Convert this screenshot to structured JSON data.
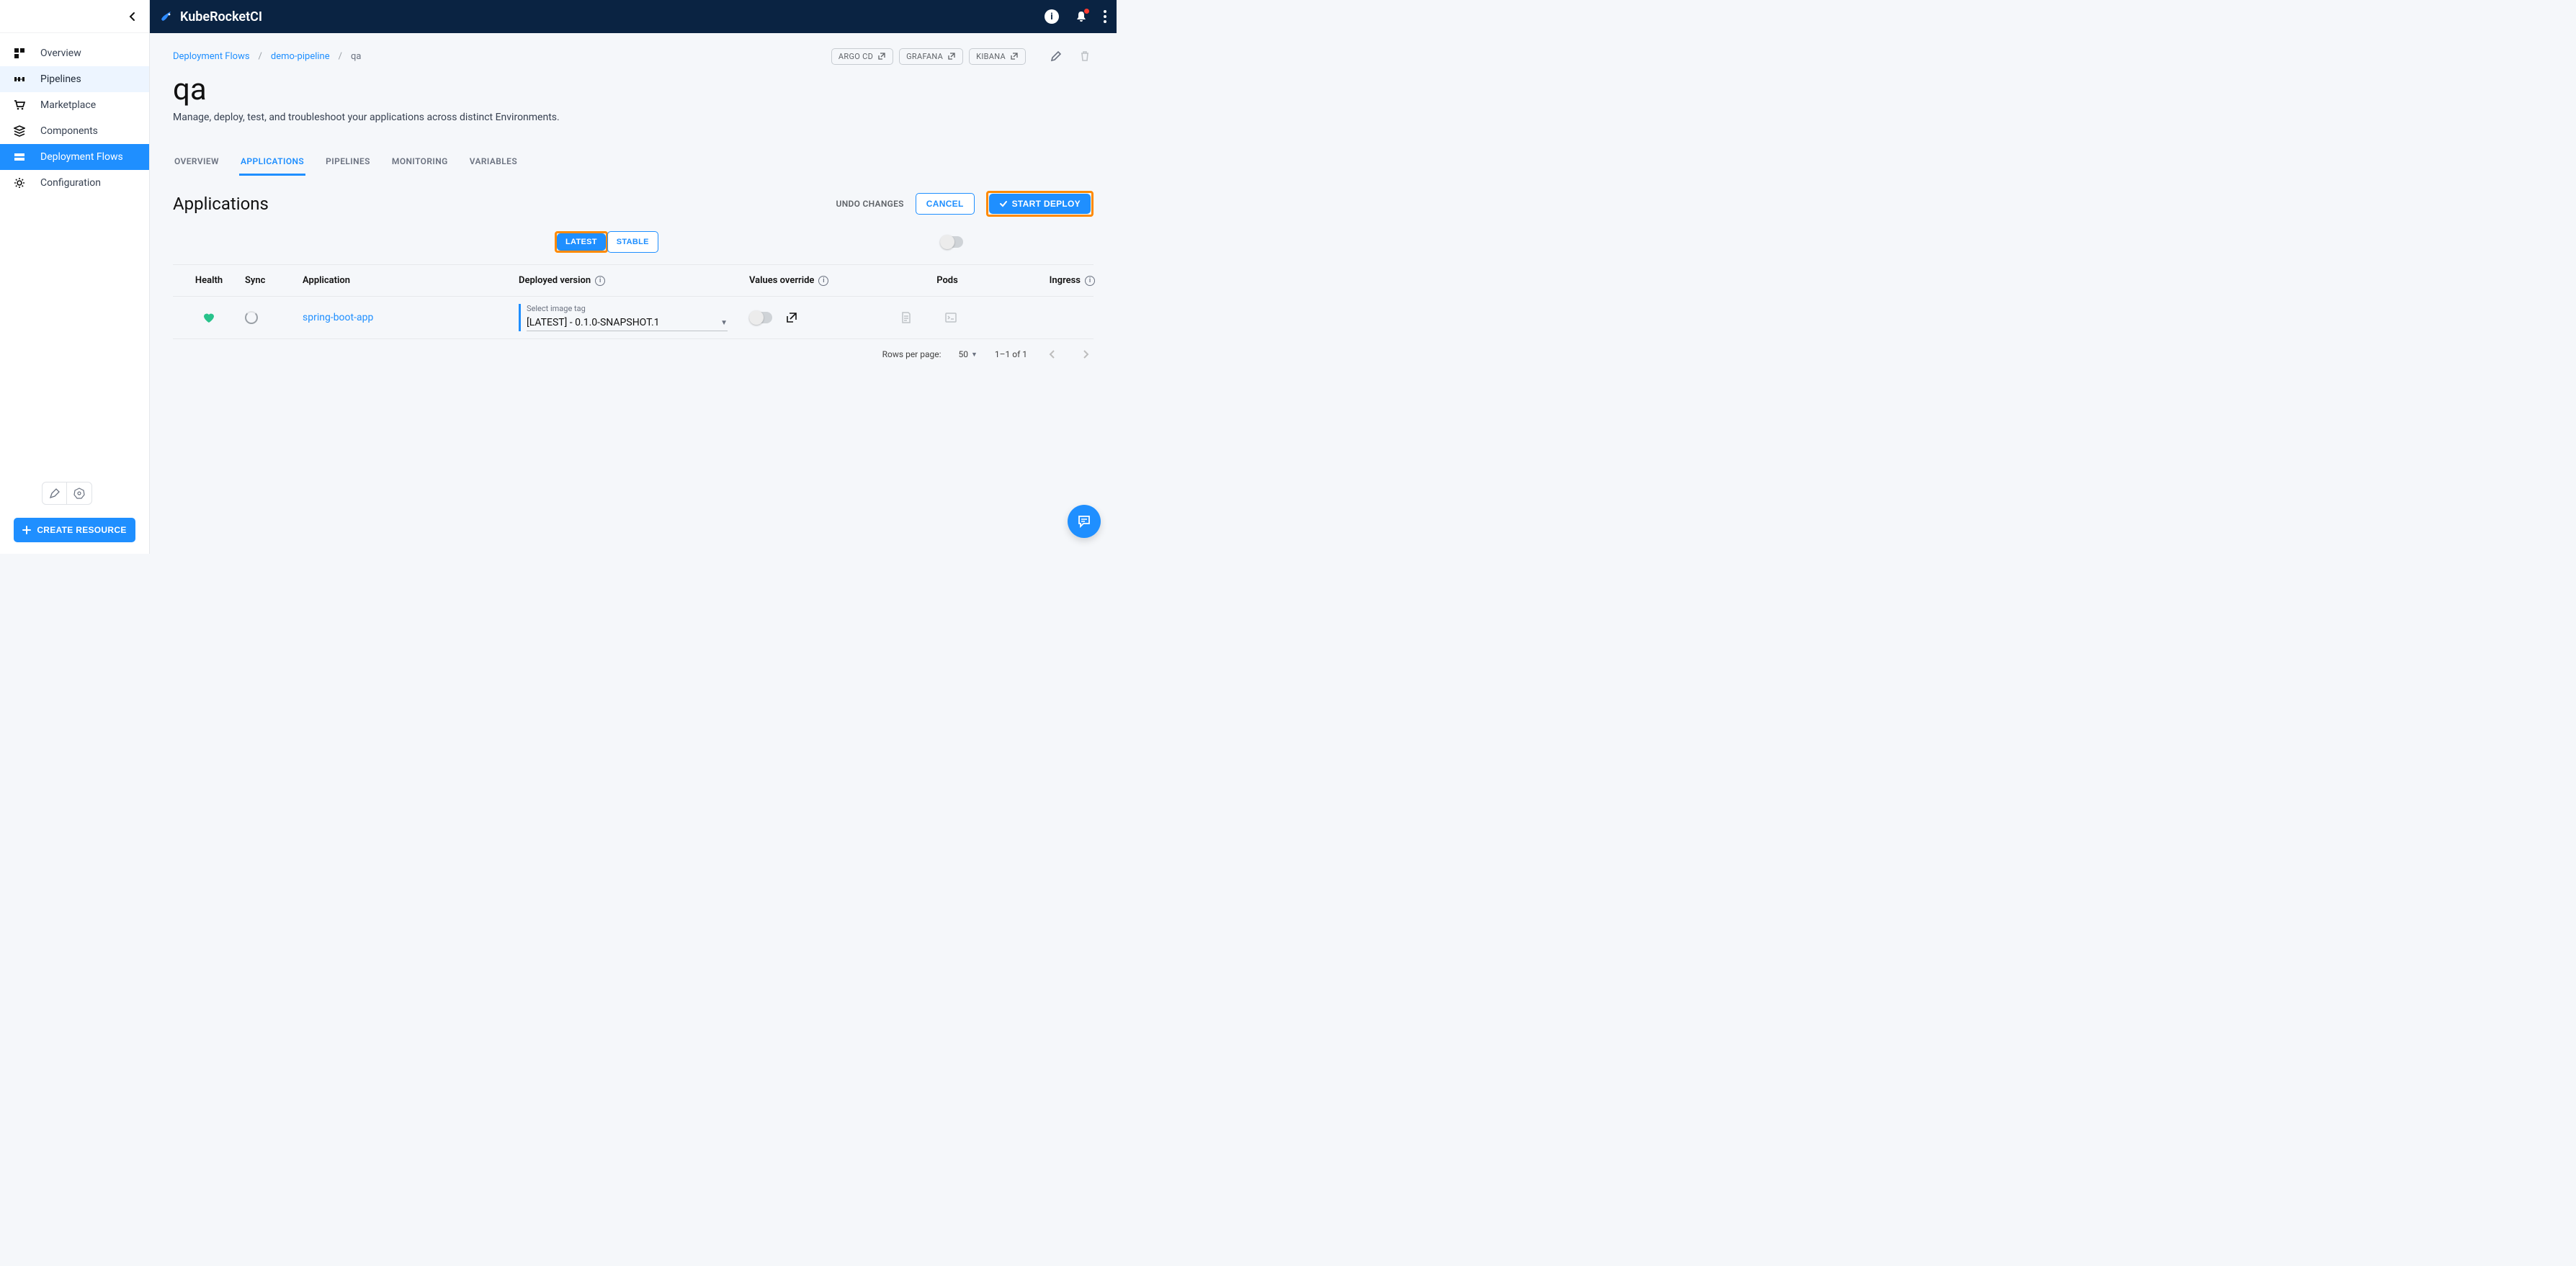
{
  "brand": {
    "name": "KubeRocketCI"
  },
  "sidebar": {
    "items": [
      {
        "label": "Overview"
      },
      {
        "label": "Pipelines"
      },
      {
        "label": "Marketplace"
      },
      {
        "label": "Components"
      },
      {
        "label": "Deployment Flows"
      },
      {
        "label": "Configuration"
      }
    ],
    "create_resource": "CREATE RESOURCE"
  },
  "breadcrumbs": {
    "root": "Deployment Flows",
    "pipeline": "demo-pipeline",
    "stage": "qa"
  },
  "chips": {
    "argocd": "ARGO CD",
    "grafana": "GRAFANA",
    "kibana": "KIBANA"
  },
  "page": {
    "title": "qa",
    "subtitle": "Manage, deploy, test, and troubleshoot your applications across distinct Environments."
  },
  "tabs": {
    "overview": "OVERVIEW",
    "applications": "APPLICATIONS",
    "pipelines": "PIPELINES",
    "monitoring": "MONITORING",
    "variables": "VARIABLES"
  },
  "section": {
    "title": "Applications",
    "undo": "UNDO CHANGES",
    "cancel": "CANCEL",
    "start_deploy": "START DEPLOY"
  },
  "segmented": {
    "latest": "LATEST",
    "stable": "STABLE"
  },
  "table": {
    "headers": {
      "health": "Health",
      "sync": "Sync",
      "application": "Application",
      "deployed_version": "Deployed version",
      "values_override": "Values override",
      "pods": "Pods",
      "ingress": "Ingress"
    },
    "rows": [
      {
        "app_name": "spring-boot-app",
        "select_label": "Select image tag",
        "image_tag": "[LATEST] - 0.1.0-SNAPSHOT.1"
      }
    ]
  },
  "pagination": {
    "rows_label": "Rows per page:",
    "rows_value": "50",
    "range": "1–1 of 1"
  }
}
